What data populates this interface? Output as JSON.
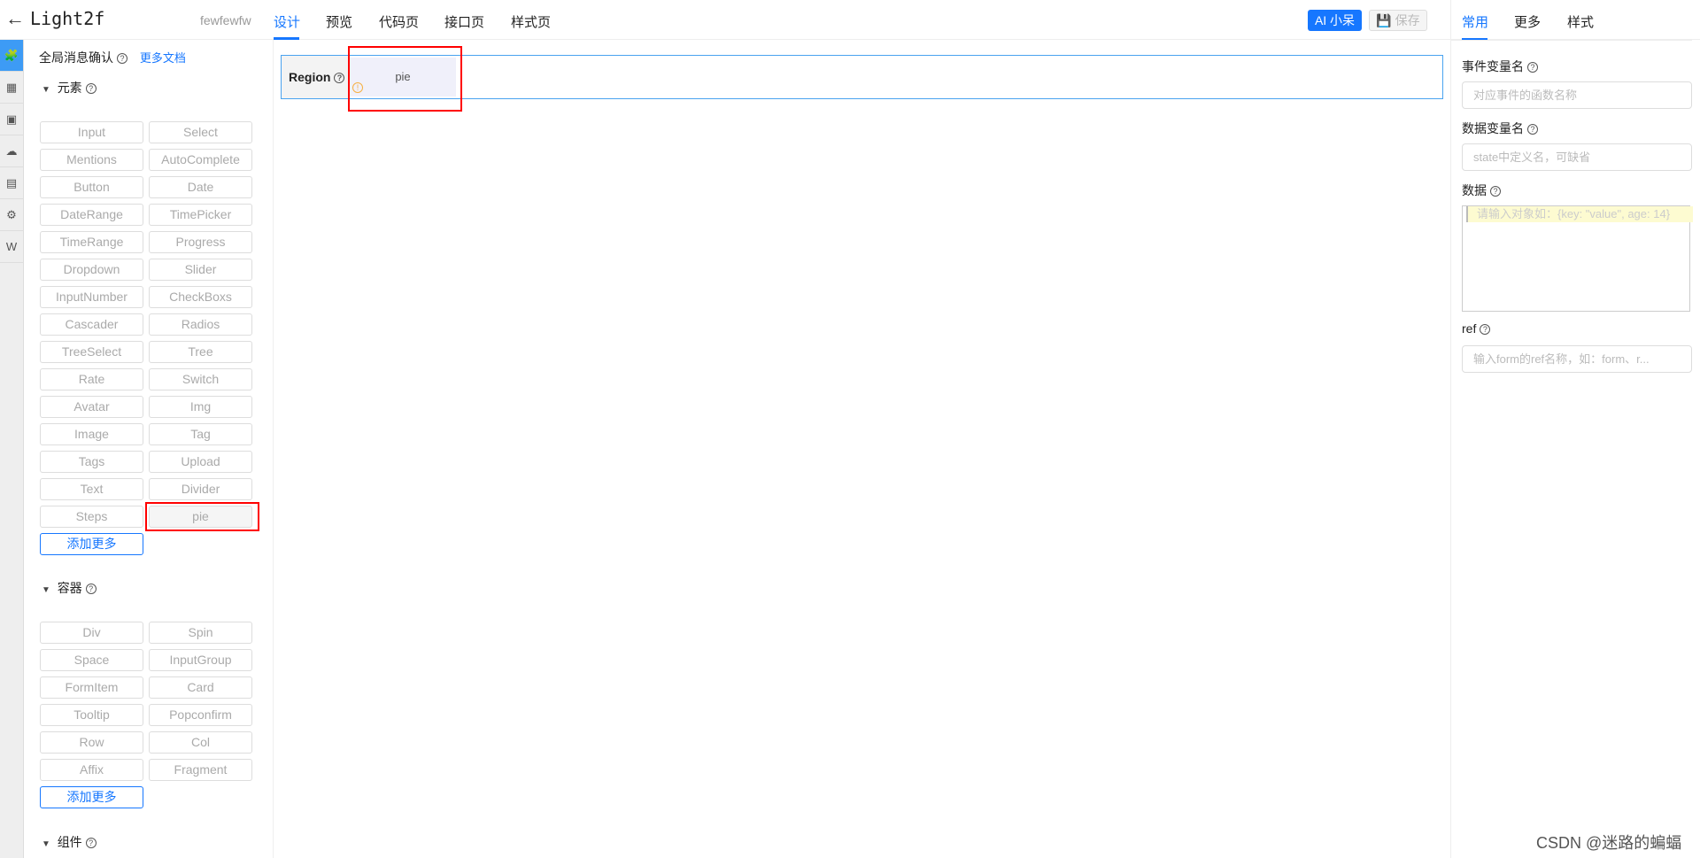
{
  "header": {
    "title": "Light2f",
    "project": "fewfewfw",
    "tabs": [
      "设计",
      "预览",
      "代码页",
      "接口页",
      "样式页"
    ],
    "active_tab": "设计",
    "ai_button": "AI 小呆",
    "save_button": "保存"
  },
  "iconbar": [
    "puzzle-icon",
    "grid-icon",
    "window-icon",
    "api-cloud-icon",
    "image-icon",
    "settings-list-icon",
    "word-icon"
  ],
  "left": {
    "global_msg": "全局消息确认",
    "more_docs": "更多文档",
    "sections": [
      {
        "title": "元素",
        "items": [
          "Input",
          "Select",
          "Mentions",
          "AutoComplete",
          "Button",
          "Date",
          "DateRange",
          "TimePicker",
          "TimeRange",
          "Progress",
          "Dropdown",
          "Slider",
          "InputNumber",
          "CheckBoxs",
          "Cascader",
          "Radios",
          "TreeSelect",
          "Tree",
          "Rate",
          "Switch",
          "Avatar",
          "Img",
          "Image",
          "Tag",
          "Tags",
          "Upload",
          "Text",
          "Divider",
          "Steps",
          "pie"
        ],
        "add_more": "添加更多"
      },
      {
        "title": "容器",
        "items": [
          "Div",
          "Spin",
          "Space",
          "InputGroup",
          "FormItem",
          "Card",
          "Tooltip",
          "Popconfirm",
          "Row",
          "Col",
          "Affix",
          "Fragment"
        ],
        "add_more": "添加更多"
      },
      {
        "title": "组件"
      }
    ]
  },
  "canvas": {
    "region_label": "Region",
    "block": "pie"
  },
  "right": {
    "tabs": [
      "常用",
      "更多",
      "样式"
    ],
    "active_tab": "常用",
    "fields": [
      {
        "label": "事件变量名",
        "placeholder": "对应事件的函数名称"
      },
      {
        "label": "数据变量名",
        "placeholder": "state中定义名，可缺省"
      },
      {
        "label": "数据",
        "placeholder": "请输入对象如：{key: \"value\", age: 14}"
      },
      {
        "label": "ref",
        "placeholder": "输入form的ref名称，如：form、r..."
      }
    ]
  },
  "watermark": "CSDN @迷路的蝙蝠",
  "colors": {
    "accent": "#1677ff",
    "highlight": "#ff0000"
  }
}
